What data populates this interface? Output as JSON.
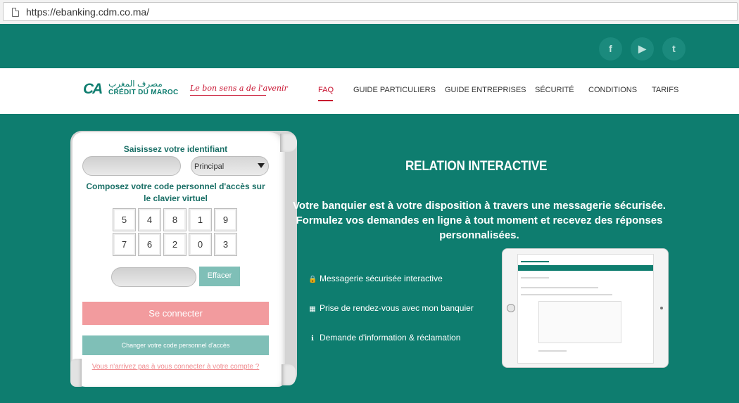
{
  "browser": {
    "url": "https://ebanking.cdm.co.ma/"
  },
  "social": [
    "f",
    "▶",
    "t"
  ],
  "brand": {
    "arabic": "مصرف المغرب",
    "name": "CRÉDIT DU MAROC",
    "slogan": "Le bon sens a de l'avenir"
  },
  "nav": {
    "items": [
      {
        "label": "FAQ",
        "active": true
      },
      {
        "label": "GUIDE PARTICULIERS"
      },
      {
        "label": "GUIDE ENTREPRISES"
      },
      {
        "label": "SÉCURITÉ"
      },
      {
        "label": "CONDITIONS"
      },
      {
        "label": "TARIFS"
      }
    ]
  },
  "login": {
    "id_label": "Saisissez votre identifiant",
    "account_type": "Principal",
    "code_label": "Composez votre code personnel d'accès sur le clavier virtuel",
    "keypad": [
      "5",
      "4",
      "8",
      "1",
      "9",
      "7",
      "6",
      "2",
      "0",
      "3"
    ],
    "clear_label": "Effacer",
    "login_label": "Se connecter",
    "change_code_label": "Changer votre code personnel d'accès",
    "help_link": "Vous n'arrivez pas à vous connecter à votre compte ?"
  },
  "promo": {
    "title": "RELATION INTERACTIVE",
    "description": "Votre banquier est à votre disposition à travers une messagerie sécurisée. Formulez vos demandes en ligne à tout moment et recevez des réponses personnalisées.",
    "features": [
      {
        "icon": "lock-icon",
        "label": "Messagerie sécurisée interactive"
      },
      {
        "icon": "calendar-icon",
        "label": "Prise de rendez-vous avec mon banquier"
      },
      {
        "icon": "info-icon",
        "label": "Demande d'information & réclamation"
      }
    ]
  },
  "colors": {
    "brand_teal": "#0e7d6f",
    "accent_red": "#c8102e",
    "login_pink": "#f29b9e",
    "soft_teal": "#7fbfb7"
  }
}
